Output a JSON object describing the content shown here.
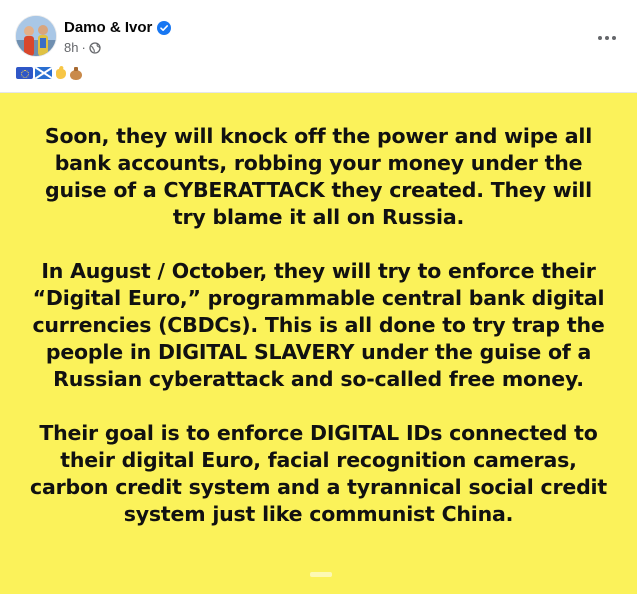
{
  "post": {
    "author": "Damo & Ivor",
    "timestamp": "8h",
    "separator": "·",
    "verified_icon": "verified-badge-icon",
    "privacy_icon": "globe-icon",
    "more_icon": "more-options-icon",
    "caption_emojis": [
      "eu-flag-emoji",
      "scotland-flag-emoji",
      "raised-fist-emoji",
      "money-bag-emoji"
    ]
  },
  "image": {
    "background_color": "#fbf25a",
    "paragraphs": [
      "Soon, they will knock off the power and wipe all bank accounts, robbing your money under the guise of a CYBERATTACK they created. They will try blame it all on Russia.",
      "In August / October, they will try to enforce their “Digital Euro,” programmable central bank digital currencies (CBDCs). This is all done to try trap the people in DIGITAL SLAVERY under the guise of a Russian cyberattack and so-called free money.",
      "Their goal is to enforce DIGITAL IDs connected to their digital Euro, facial recognition cameras, carbon credit system and a tyrannical social credit system just like communist China."
    ]
  },
  "colors": {
    "accent": "#1877f2",
    "text_primary": "#050505",
    "text_secondary": "#65676b"
  }
}
